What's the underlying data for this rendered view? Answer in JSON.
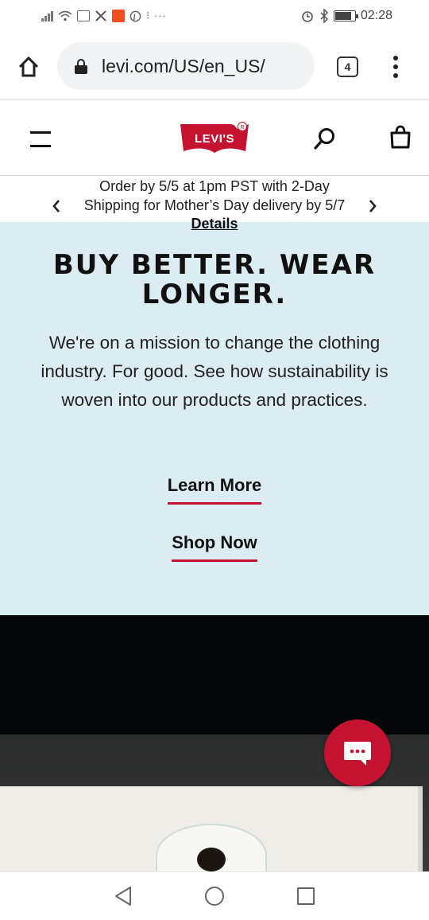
{
  "status_bar": {
    "time": "02:28",
    "icons": [
      "signal-icon",
      "wifi-icon",
      "laptop-icon",
      "tools-icon",
      "app-notification-icon",
      "pinterest-icon",
      "more-icon",
      "alarm-icon",
      "bluetooth-icon",
      "battery-icon"
    ],
    "more_glyph": "⁝ ···"
  },
  "browser": {
    "url": "levi.com/US/en_US/",
    "tab_count": "4"
  },
  "site_header": {
    "logo_text": "LEVI'S",
    "brand_color": "#c41230"
  },
  "promo": {
    "line1": "Order by 5/5 at 1pm PST with 2-Day",
    "line2": "Shipping for Mother’s Day delivery by 5/7",
    "prev_glyph": "‹",
    "next_glyph": "›",
    "details_label": "Details"
  },
  "hero": {
    "headline": "BUY BETTER. WEAR LONGER.",
    "body": "We're on a mission to change the clothing industry. For good. See how sustainability is woven into our products and practices.",
    "learn_more_label": "Learn More",
    "shop_now_label": "Shop Now",
    "background_color": "#dcecf3"
  }
}
